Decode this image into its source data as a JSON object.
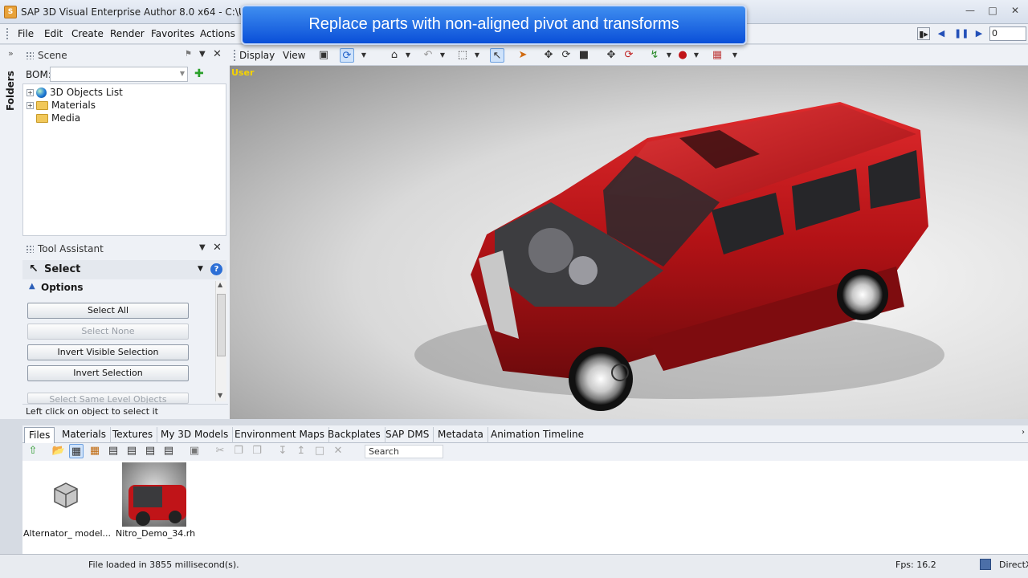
{
  "window": {
    "title": "SAP 3D Visual Enterprise Author 8.0 x64 - C:\\Users\\"
  },
  "banner": {
    "text": "Replace parts with non-aligned pivot and transforms"
  },
  "menu": [
    "File",
    "Edit",
    "Create",
    "Render",
    "Favorites",
    "Actions"
  ],
  "playback": {
    "frame_value": "0"
  },
  "scene": {
    "title": "Scene",
    "bom_label": "BOM:",
    "tree": [
      "3D Objects List",
      "Materials",
      "Media"
    ]
  },
  "folders_tab": "Folders",
  "tool_assistant": {
    "title": "Tool Assistant",
    "tool_name": "Select",
    "options_label": "Options",
    "buttons": [
      "Select All",
      "Select None",
      "Invert Visible Selection",
      "Invert Selection",
      "Select Same Level Objects"
    ],
    "hint": "Left click on object to select it"
  },
  "view_toolbar": {
    "display_label": "Display",
    "view_label": "View"
  },
  "viewport": {
    "camera_label": "User"
  },
  "bottom_tabs": [
    "Files",
    "Materials",
    "Textures",
    "My 3D Models",
    "Environment Maps",
    "Backplates",
    "SAP DMS",
    "Metadata",
    "Animation Timeline"
  ],
  "files": {
    "search_placeholder": "Search",
    "items": [
      "Alternator_ model...",
      "Nitro_Demo_34.rh"
    ]
  },
  "status": {
    "message": "File loaded in 3855 millisecond(s).",
    "fps": "Fps: 16.2",
    "renderer": "DirectX"
  },
  "colors": {
    "banner": "#1f6ae6",
    "car": "#c01418",
    "camera_label": "#f5d300"
  }
}
